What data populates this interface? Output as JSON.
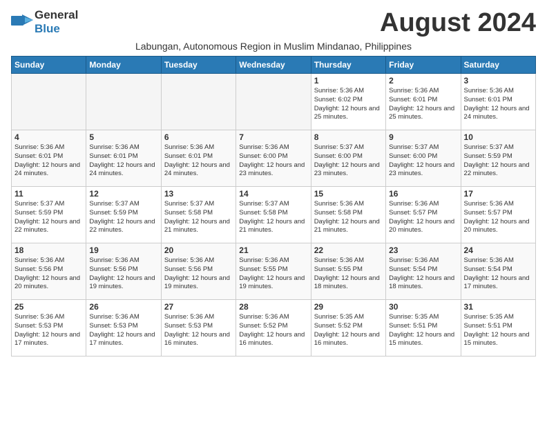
{
  "header": {
    "logo_general": "General",
    "logo_blue": "Blue",
    "month_title": "August 2024",
    "subtitle": "Labungan, Autonomous Region in Muslim Mindanao, Philippines"
  },
  "days_of_week": [
    "Sunday",
    "Monday",
    "Tuesday",
    "Wednesday",
    "Thursday",
    "Friday",
    "Saturday"
  ],
  "weeks": [
    [
      {
        "day": "",
        "sunrise": "",
        "sunset": "",
        "daylight": "",
        "empty": true
      },
      {
        "day": "",
        "sunrise": "",
        "sunset": "",
        "daylight": "",
        "empty": true
      },
      {
        "day": "",
        "sunrise": "",
        "sunset": "",
        "daylight": "",
        "empty": true
      },
      {
        "day": "",
        "sunrise": "",
        "sunset": "",
        "daylight": "",
        "empty": true
      },
      {
        "day": "1",
        "sunrise": "Sunrise: 5:36 AM",
        "sunset": "Sunset: 6:02 PM",
        "daylight": "Daylight: 12 hours and 25 minutes.",
        "empty": false
      },
      {
        "day": "2",
        "sunrise": "Sunrise: 5:36 AM",
        "sunset": "Sunset: 6:01 PM",
        "daylight": "Daylight: 12 hours and 25 minutes.",
        "empty": false
      },
      {
        "day": "3",
        "sunrise": "Sunrise: 5:36 AM",
        "sunset": "Sunset: 6:01 PM",
        "daylight": "Daylight: 12 hours and 24 minutes.",
        "empty": false
      }
    ],
    [
      {
        "day": "4",
        "sunrise": "Sunrise: 5:36 AM",
        "sunset": "Sunset: 6:01 PM",
        "daylight": "Daylight: 12 hours and 24 minutes.",
        "empty": false
      },
      {
        "day": "5",
        "sunrise": "Sunrise: 5:36 AM",
        "sunset": "Sunset: 6:01 PM",
        "daylight": "Daylight: 12 hours and 24 minutes.",
        "empty": false
      },
      {
        "day": "6",
        "sunrise": "Sunrise: 5:36 AM",
        "sunset": "Sunset: 6:01 PM",
        "daylight": "Daylight: 12 hours and 24 minutes.",
        "empty": false
      },
      {
        "day": "7",
        "sunrise": "Sunrise: 5:36 AM",
        "sunset": "Sunset: 6:00 PM",
        "daylight": "Daylight: 12 hours and 23 minutes.",
        "empty": false
      },
      {
        "day": "8",
        "sunrise": "Sunrise: 5:37 AM",
        "sunset": "Sunset: 6:00 PM",
        "daylight": "Daylight: 12 hours and 23 minutes.",
        "empty": false
      },
      {
        "day": "9",
        "sunrise": "Sunrise: 5:37 AM",
        "sunset": "Sunset: 6:00 PM",
        "daylight": "Daylight: 12 hours and 23 minutes.",
        "empty": false
      },
      {
        "day": "10",
        "sunrise": "Sunrise: 5:37 AM",
        "sunset": "Sunset: 5:59 PM",
        "daylight": "Daylight: 12 hours and 22 minutes.",
        "empty": false
      }
    ],
    [
      {
        "day": "11",
        "sunrise": "Sunrise: 5:37 AM",
        "sunset": "Sunset: 5:59 PM",
        "daylight": "Daylight: 12 hours and 22 minutes.",
        "empty": false
      },
      {
        "day": "12",
        "sunrise": "Sunrise: 5:37 AM",
        "sunset": "Sunset: 5:59 PM",
        "daylight": "Daylight: 12 hours and 22 minutes.",
        "empty": false
      },
      {
        "day": "13",
        "sunrise": "Sunrise: 5:37 AM",
        "sunset": "Sunset: 5:58 PM",
        "daylight": "Daylight: 12 hours and 21 minutes.",
        "empty": false
      },
      {
        "day": "14",
        "sunrise": "Sunrise: 5:37 AM",
        "sunset": "Sunset: 5:58 PM",
        "daylight": "Daylight: 12 hours and 21 minutes.",
        "empty": false
      },
      {
        "day": "15",
        "sunrise": "Sunrise: 5:36 AM",
        "sunset": "Sunset: 5:58 PM",
        "daylight": "Daylight: 12 hours and 21 minutes.",
        "empty": false
      },
      {
        "day": "16",
        "sunrise": "Sunrise: 5:36 AM",
        "sunset": "Sunset: 5:57 PM",
        "daylight": "Daylight: 12 hours and 20 minutes.",
        "empty": false
      },
      {
        "day": "17",
        "sunrise": "Sunrise: 5:36 AM",
        "sunset": "Sunset: 5:57 PM",
        "daylight": "Daylight: 12 hours and 20 minutes.",
        "empty": false
      }
    ],
    [
      {
        "day": "18",
        "sunrise": "Sunrise: 5:36 AM",
        "sunset": "Sunset: 5:56 PM",
        "daylight": "Daylight: 12 hours and 20 minutes.",
        "empty": false
      },
      {
        "day": "19",
        "sunrise": "Sunrise: 5:36 AM",
        "sunset": "Sunset: 5:56 PM",
        "daylight": "Daylight: 12 hours and 19 minutes.",
        "empty": false
      },
      {
        "day": "20",
        "sunrise": "Sunrise: 5:36 AM",
        "sunset": "Sunset: 5:56 PM",
        "daylight": "Daylight: 12 hours and 19 minutes.",
        "empty": false
      },
      {
        "day": "21",
        "sunrise": "Sunrise: 5:36 AM",
        "sunset": "Sunset: 5:55 PM",
        "daylight": "Daylight: 12 hours and 19 minutes.",
        "empty": false
      },
      {
        "day": "22",
        "sunrise": "Sunrise: 5:36 AM",
        "sunset": "Sunset: 5:55 PM",
        "daylight": "Daylight: 12 hours and 18 minutes.",
        "empty": false
      },
      {
        "day": "23",
        "sunrise": "Sunrise: 5:36 AM",
        "sunset": "Sunset: 5:54 PM",
        "daylight": "Daylight: 12 hours and 18 minutes.",
        "empty": false
      },
      {
        "day": "24",
        "sunrise": "Sunrise: 5:36 AM",
        "sunset": "Sunset: 5:54 PM",
        "daylight": "Daylight: 12 hours and 17 minutes.",
        "empty": false
      }
    ],
    [
      {
        "day": "25",
        "sunrise": "Sunrise: 5:36 AM",
        "sunset": "Sunset: 5:53 PM",
        "daylight": "Daylight: 12 hours and 17 minutes.",
        "empty": false
      },
      {
        "day": "26",
        "sunrise": "Sunrise: 5:36 AM",
        "sunset": "Sunset: 5:53 PM",
        "daylight": "Daylight: 12 hours and 17 minutes.",
        "empty": false
      },
      {
        "day": "27",
        "sunrise": "Sunrise: 5:36 AM",
        "sunset": "Sunset: 5:53 PM",
        "daylight": "Daylight: 12 hours and 16 minutes.",
        "empty": false
      },
      {
        "day": "28",
        "sunrise": "Sunrise: 5:36 AM",
        "sunset": "Sunset: 5:52 PM",
        "daylight": "Daylight: 12 hours and 16 minutes.",
        "empty": false
      },
      {
        "day": "29",
        "sunrise": "Sunrise: 5:35 AM",
        "sunset": "Sunset: 5:52 PM",
        "daylight": "Daylight: 12 hours and 16 minutes.",
        "empty": false
      },
      {
        "day": "30",
        "sunrise": "Sunrise: 5:35 AM",
        "sunset": "Sunset: 5:51 PM",
        "daylight": "Daylight: 12 hours and 15 minutes.",
        "empty": false
      },
      {
        "day": "31",
        "sunrise": "Sunrise: 5:35 AM",
        "sunset": "Sunset: 5:51 PM",
        "daylight": "Daylight: 12 hours and 15 minutes.",
        "empty": false
      }
    ]
  ]
}
